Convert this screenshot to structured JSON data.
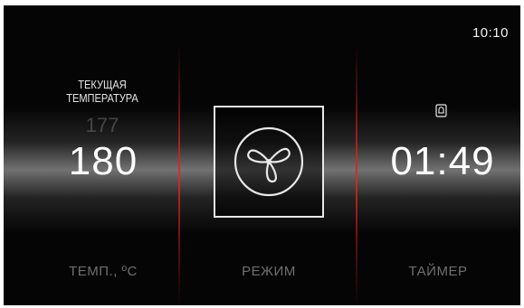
{
  "status": {
    "clock": "10:10"
  },
  "temperature": {
    "label": "ТЕКУЩАЯ ТЕМПЕРАТУРА",
    "current": "177",
    "set_value": "180",
    "caption": "ТЕМП., ºC"
  },
  "mode": {
    "icon": "fan-icon",
    "caption": "РЕЖИМ"
  },
  "timer": {
    "icon": "bell-icon",
    "value": "01:49",
    "caption": "ТАЙМЕР"
  },
  "colors": {
    "background": "#050505",
    "accent_divider": "#d42a2a",
    "text_primary": "#ffffff",
    "text_muted": "#6f6f6f"
  }
}
